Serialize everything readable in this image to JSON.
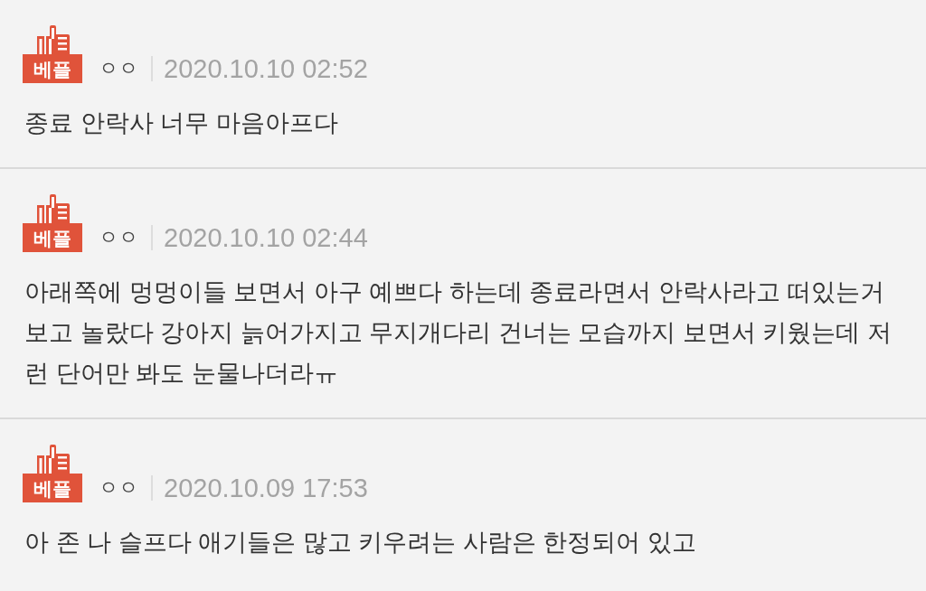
{
  "comments": [
    {
      "badge": "베플",
      "author": "ㅇㅇ",
      "date": "2020.10.10 02:52",
      "text": "종료 안락사 너무 마음아프다"
    },
    {
      "badge": "베플",
      "author": "ㅇㅇ",
      "date": "2020.10.10 02:44",
      "text": "아래쪽에 멍멍이들 보면서 아구 예쁘다 하는데 종료라면서 안락사라고 떠있는거 보고 놀랐다 강아지 늙어가지고 무지개다리 건너는 모습까지 보면서 키웠는데 저런 단어만 봐도 눈물나더라ㅠ"
    },
    {
      "badge": "베플",
      "author": "ㅇㅇ",
      "date": "2020.10.09 17:53",
      "text": "아 존 나 슬프다 애기들은 많고 키우려는 사람은 한정되어 있고"
    }
  ]
}
